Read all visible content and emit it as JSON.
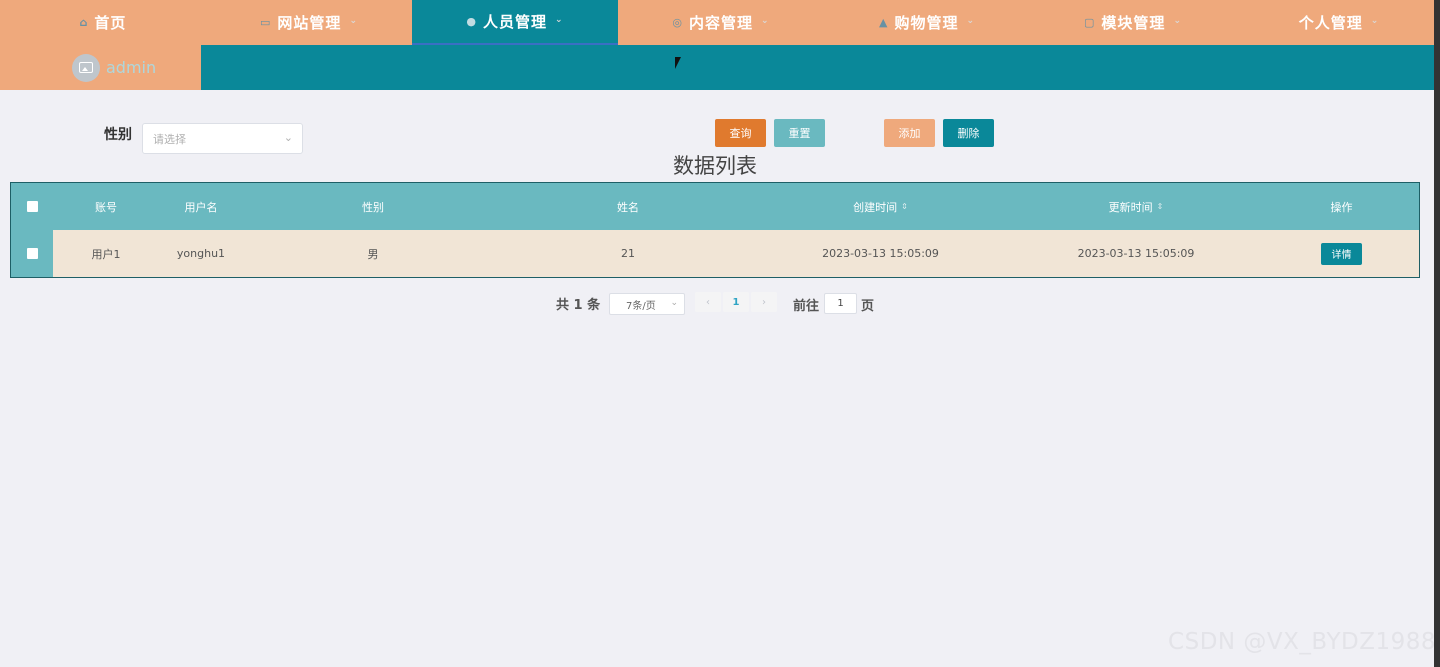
{
  "nav": {
    "items": [
      {
        "label": "首页",
        "icon": "home-icon",
        "glyph": "⌂",
        "arrow": ""
      },
      {
        "label": "网站管理",
        "icon": "monitor-icon",
        "glyph": "▭",
        "arrow": "⌄"
      },
      {
        "label": "人员管理",
        "icon": "user-icon",
        "glyph": "●",
        "arrow": "⌄"
      },
      {
        "label": "内容管理",
        "icon": "settings-icon",
        "glyph": "◎",
        "arrow": "⌄"
      },
      {
        "label": "购物管理",
        "icon": "bag-icon",
        "glyph": "▲",
        "arrow": "⌄"
      },
      {
        "label": "模块管理",
        "icon": "module-icon",
        "glyph": "▢",
        "arrow": "⌄"
      },
      {
        "label": "个人管理",
        "icon": "",
        "glyph": "",
        "arrow": "⌄"
      }
    ],
    "active_index": 2
  },
  "user": {
    "name": "admin",
    "avatar_icon": "image-icon"
  },
  "search": {
    "gender_label": "性别",
    "gender_placeholder": "请选择",
    "query_label": "查询",
    "reset_label": "重置",
    "add_label": "添加",
    "delete_label": "删除"
  },
  "list_title": "数据列表",
  "table": {
    "headers": {
      "index": "账号",
      "username": "用户名",
      "gender": "性别",
      "name": "姓名",
      "created": "创建时间",
      "updated": "更新时间",
      "op": "操作"
    },
    "rows": [
      {
        "index": "用户1",
        "username": "yonghu1",
        "gender": "男",
        "name": "21",
        "created": "2023-03-13 15:05:09",
        "updated": "2023-03-13 15:05:09",
        "op_label": "详情"
      }
    ]
  },
  "pagination": {
    "total_text": "共 1 条",
    "page_size": "7条/页",
    "current_page": "1",
    "goto_prefix": "前往",
    "goto_value": "1",
    "goto_suffix": "页"
  },
  "watermark": "CSDN @VX_BYDZ1988",
  "colors": {
    "accent_orange": "#efa97c",
    "accent_teal": "#0a8899",
    "header_teal": "#6ab9c0",
    "row_beige": "#f1e5d6",
    "query_orange": "#e07a2e"
  }
}
